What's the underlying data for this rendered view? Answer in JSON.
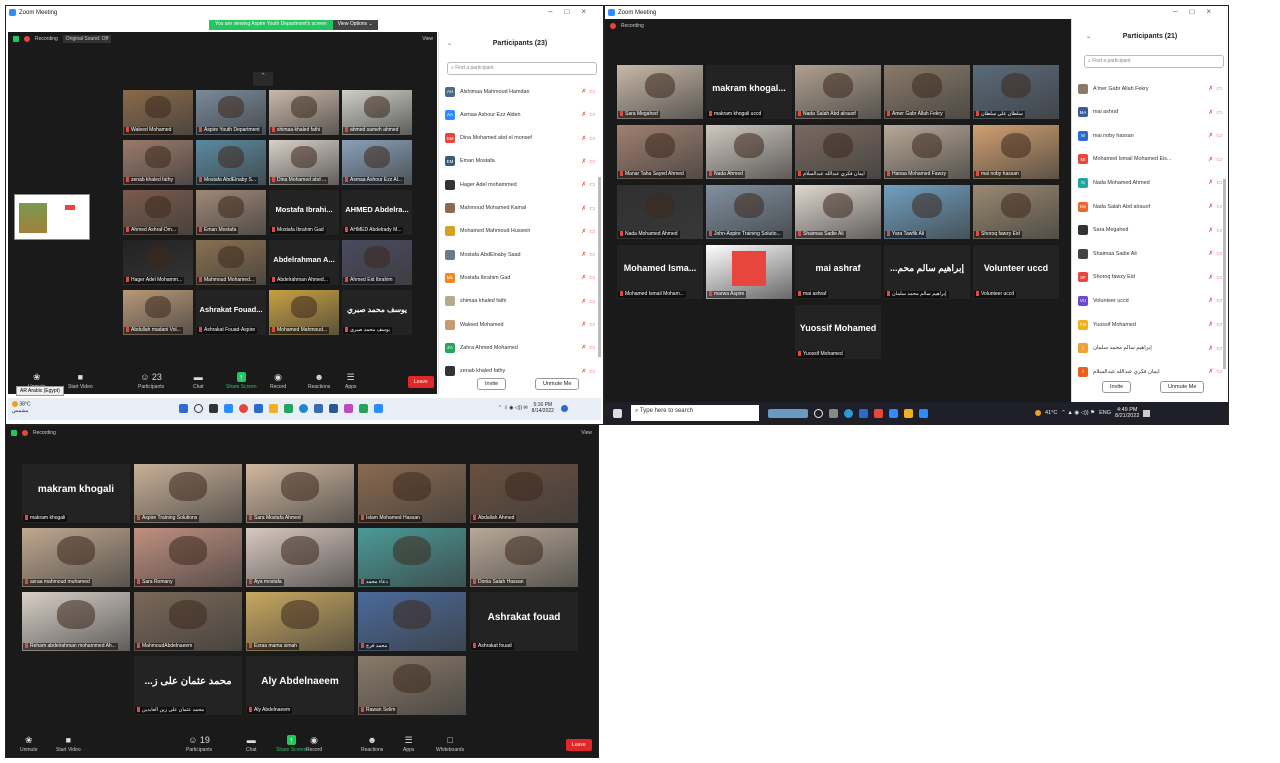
{
  "s1": {
    "title": "Zoom Meeting",
    "banner": "You are viewing Aspire Youth Department's screen",
    "view_options": "View Options ⌄",
    "recording": "Recording",
    "sound": "Original Sound: Off",
    "view": "View",
    "tiles": [
      {
        "label": "Waleed Mohamed",
        "color": "#8a6a4a"
      },
      {
        "label": "Aspire Youth Department",
        "color": "#7a8a9a",
        "active": true
      },
      {
        "label": "shimaa khaled fathi",
        "color": "#c8b8a8"
      },
      {
        "label": "ahmed sameh ahmed",
        "color": "#cfcfc8"
      },
      {
        "label": "zenab khaled fathy",
        "color": "#9a7a6a"
      },
      {
        "label": "Mostafa AbdElnaby S...",
        "color": "#5a8aa0"
      },
      {
        "label": "Dina Mohamed abd ...",
        "color": "#d8d0c8"
      },
      {
        "label": "Asmaa Ashour Ezz Al...",
        "color": "#8aa0b8"
      },
      {
        "label": "Ahmed Ashraf-Dm...",
        "color": "#7a5a4a"
      },
      {
        "label": "Eman Mostafa",
        "color": "#a08878"
      },
      {
        "name": "Mostafa Ibrahi...",
        "label": "Mostafa Ibrahim Gad"
      },
      {
        "name": "AHMED Abdelra...",
        "label": "AHMED Abdelrady M..."
      },
      {
        "label": "Hager Adel Mohamm...",
        "color": "#222222"
      },
      {
        "label": "Mahmoud Mohamed...",
        "color": "#8a7050"
      },
      {
        "name": "Abdelrahman A...",
        "label": "Abdelrahman Ahmed..."
      },
      {
        "label": "Ahmed Eid Ibrahim",
        "color": "#4a4a60"
      },
      {
        "label": "Abdullah madani Vol...",
        "color": "#b89878"
      },
      {
        "name": "Ashrakat Fouad...",
        "label": "Ashrakat Fouad-Aspire"
      },
      {
        "label": "Mohamed Mahmoud...",
        "color": "#c8a040"
      },
      {
        "name": "يوسف محمد صبري",
        "label": "يوسف محمد صبري"
      }
    ],
    "bottom": [
      {
        "icon": "❀",
        "label": "Unmute"
      },
      {
        "icon": "■",
        "label": "Start Video"
      },
      {
        "icon": "☺ 23",
        "label": "Participants"
      },
      {
        "icon": "▬",
        "label": "Chat"
      },
      {
        "icon": "↑",
        "label": "Share Screen"
      },
      {
        "icon": "◉",
        "label": "Record"
      },
      {
        "icon": "☻",
        "label": "Reactions"
      },
      {
        "icon": "☰",
        "label": "Apps"
      }
    ],
    "leave": "Leave",
    "panel_title": "Participants (23)",
    "search_placeholder": "Find a participant",
    "participants": [
      {
        "init": "AH",
        "color": "#4a6a8a",
        "name": "Alshimaa Mahmoud Hamdan"
      },
      {
        "init": "AA",
        "color": "#2d8cff",
        "name": "Asmaa Ashour Ezz Alden"
      },
      {
        "init": "DM",
        "color": "#e8453c",
        "name": "Dina Mohamed abd el monsef"
      },
      {
        "init": "EM",
        "color": "#3a5a7a",
        "name": "Eman Mostafa"
      },
      {
        "init": "",
        "color": "#333333",
        "name": "Hager Adel mohammed"
      },
      {
        "init": "",
        "color": "#8a6a50",
        "name": "Mahmoud Mohamed Kamal"
      },
      {
        "init": "",
        "color": "#d8a020",
        "name": "Mohamed Mahmoud Hussein"
      },
      {
        "init": "",
        "color": "#6a7a8a",
        "name": "Mostafa AbdElnaby Saad"
      },
      {
        "init": "ML",
        "color": "#f08a20",
        "name": "Mostafa Ibrahim Gad"
      },
      {
        "init": "",
        "color": "#b8a890",
        "name": "shimaa khaled fathi"
      },
      {
        "init": "",
        "color": "#c89a70",
        "name": "Waleed Mohamed"
      },
      {
        "init": "ZA",
        "color": "#23a55e",
        "name": "Zahra Ahmed Mohamed"
      },
      {
        "init": "",
        "color": "#333333",
        "name": "zenab khaled fathy"
      }
    ],
    "invite": "Invite",
    "unmute_me": "Unmute Me",
    "lang": "AR Arabic (Egypt)",
    "weather": "38°C",
    "weather_sub": "مشمس",
    "time": "5:16 PM",
    "date": "8/14/2022"
  },
  "s2": {
    "title": "Zoom Meeting",
    "recording": "Recording",
    "tiles": [
      {
        "label": "Sara Megahed",
        "color": "#c8b8a8"
      },
      {
        "name": "makram khogal...",
        "label": "makram khogali uccd"
      },
      {
        "label": "Nada Salah Abd alrauof",
        "color": "#b0a090"
      },
      {
        "label": "Amer Gabr Allah Fekry",
        "color": "#8a7a6a"
      },
      {
        "label": "سلطان علي سلطان",
        "color": "#5a6a7a"
      },
      {
        "label": "Manar Taha Sayed Ahmed",
        "color": "#a08070"
      },
      {
        "label": "Nada Ahmed",
        "color": "#d0c8c0"
      },
      {
        "label": "ايمان فكري عبدالله عبدالسلام",
        "color": "#7a6a60"
      },
      {
        "label": "Hanaa Mohamed Fawzy",
        "color": "#b8a898"
      },
      {
        "label": "mai noby hassan",
        "color": "#d0a070"
      },
      {
        "label": "Nada Mohamed Ahmed",
        "color": "#303030"
      },
      {
        "label": "John-Aspire Training Solutio...",
        "color": "#8090a0",
        "active": true
      },
      {
        "label": "Shaimaa Sadie Ali",
        "color": "#e0d8d0"
      },
      {
        "label": "Yara Tawfik Ali",
        "color": "#70a0c0"
      },
      {
        "label": "Shoroq fawzy Eid",
        "color": "#9a8a70"
      },
      {
        "name": "Mohamed Isma...",
        "label": "Mohamed Ismail Moham..."
      },
      {
        "label": "marwa Aspire",
        "color": "#ffffff",
        "logo": "aspire"
      },
      {
        "name": "mai ashraf",
        "label": "mai ashraf"
      },
      {
        "name": "...إبراهيم سالم محم",
        "label": "إبراهيم سالم محمد سلمان"
      },
      {
        "name": "Volunteer uccd",
        "label": "Volunteer uccd"
      },
      {
        "name": "Yuossif Mohamed",
        "label": "Yuossif Mohamed"
      }
    ],
    "panel_title": "Participants (21)",
    "search_placeholder": "Find a participant",
    "participants": [
      {
        "init": "",
        "color": "#8a7a6a",
        "name": "A'mer Gabr Allah Fekry"
      },
      {
        "init": "MA",
        "color": "#3a5a9a",
        "name": "mai ashraf"
      },
      {
        "init": "M",
        "color": "#2d6acf",
        "name": "mai noby hassan"
      },
      {
        "init": "MI",
        "color": "#e8453c",
        "name": "Mohamed Ismail Mohamed Eis..."
      },
      {
        "init": "N",
        "color": "#23a5a0",
        "name": "Nada Mohamed Ahmed"
      },
      {
        "init": "NS",
        "color": "#e86a30",
        "name": "Nada Salah Abd alrauof"
      },
      {
        "init": "",
        "color": "#333333",
        "name": "Sara Megahed"
      },
      {
        "init": "",
        "color": "#444444",
        "name": "Shaimaa Sadie Ali"
      },
      {
        "init": "SF",
        "color": "#e8453c",
        "name": "Shoroq fawzy Eid"
      },
      {
        "init": "VU",
        "color": "#6a4acf",
        "name": "Volunteer uccd"
      },
      {
        "init": "YM",
        "color": "#f0b020",
        "name": "Yuossif Mohamed"
      },
      {
        "init": "إ",
        "color": "#f0a030",
        "name": "إبراهيم سالم محمد سلمان"
      },
      {
        "init": "ا",
        "color": "#e86020",
        "name": "ايمان فكري عبدالله عبدالسلام"
      }
    ],
    "invite": "Invite",
    "unmute_me": "Unmute Me",
    "search_taskbar": "Type here to search",
    "temp": "41°C",
    "lang": "ENG",
    "time": "4:49 PM",
    "date": "8/21/2022"
  },
  "s3": {
    "recording": "Recording",
    "view": "View",
    "tiles": [
      {
        "name": "makram khogali",
        "label": "makram khogali"
      },
      {
        "label": "Aspire Training Solutions",
        "color": "#c8b098",
        "active": true
      },
      {
        "label": "Sara Mostafa Ahmed",
        "color": "#d0b8a0"
      },
      {
        "label": "Islam Mohamed Hassan",
        "color": "#8a6a50"
      },
      {
        "label": "Abdallah Ahmed",
        "color": "#6a5040"
      },
      {
        "label": "asraa mahmoud muhamed",
        "color": "#c0a890"
      },
      {
        "label": "Sara Romany",
        "color": "#c09080"
      },
      {
        "label": "Aya mostafa",
        "color": "#d8c8c0"
      },
      {
        "label": "دعاء محمد",
        "color": "#4a9a98"
      },
      {
        "label": "Donia Salah Hassan",
        "color": "#b8a898"
      },
      {
        "label": "Reham abdelrahman mohammed Ah...",
        "color": "#d8d0c8"
      },
      {
        "label": "MahmoudAbdelnaeem",
        "color": "#7a6858"
      },
      {
        "label": "Esraa mama simah",
        "color": "#c8a860"
      },
      {
        "label": "محمد فرج",
        "color": "#4a6a9a"
      },
      {
        "name": "Ashrakat fouad",
        "label": "Ashrakat fouad"
      },
      {
        "name": "...محمد عثمان على ز",
        "label": "محمد عثمان على زين العابدين"
      },
      {
        "name": "Aly Abdelnaeem",
        "label": "Aly Abdelnaeem"
      },
      {
        "label": "Rawan Selim",
        "color": "#8a7a6a"
      }
    ],
    "bottom": [
      {
        "icon": "❀",
        "label": "Unmute"
      },
      {
        "icon": "■",
        "label": "Start Video"
      },
      {
        "icon": "☺ 19",
        "label": "Participants"
      },
      {
        "icon": "▬",
        "label": "Chat"
      },
      {
        "icon": "↑",
        "label": "Share Screen"
      },
      {
        "icon": "◉",
        "label": "Record"
      },
      {
        "icon": "☻",
        "label": "Reactions"
      },
      {
        "icon": "☰",
        "label": "Apps"
      },
      {
        "icon": "□",
        "label": "Whiteboards"
      }
    ],
    "leave": "Leave"
  }
}
